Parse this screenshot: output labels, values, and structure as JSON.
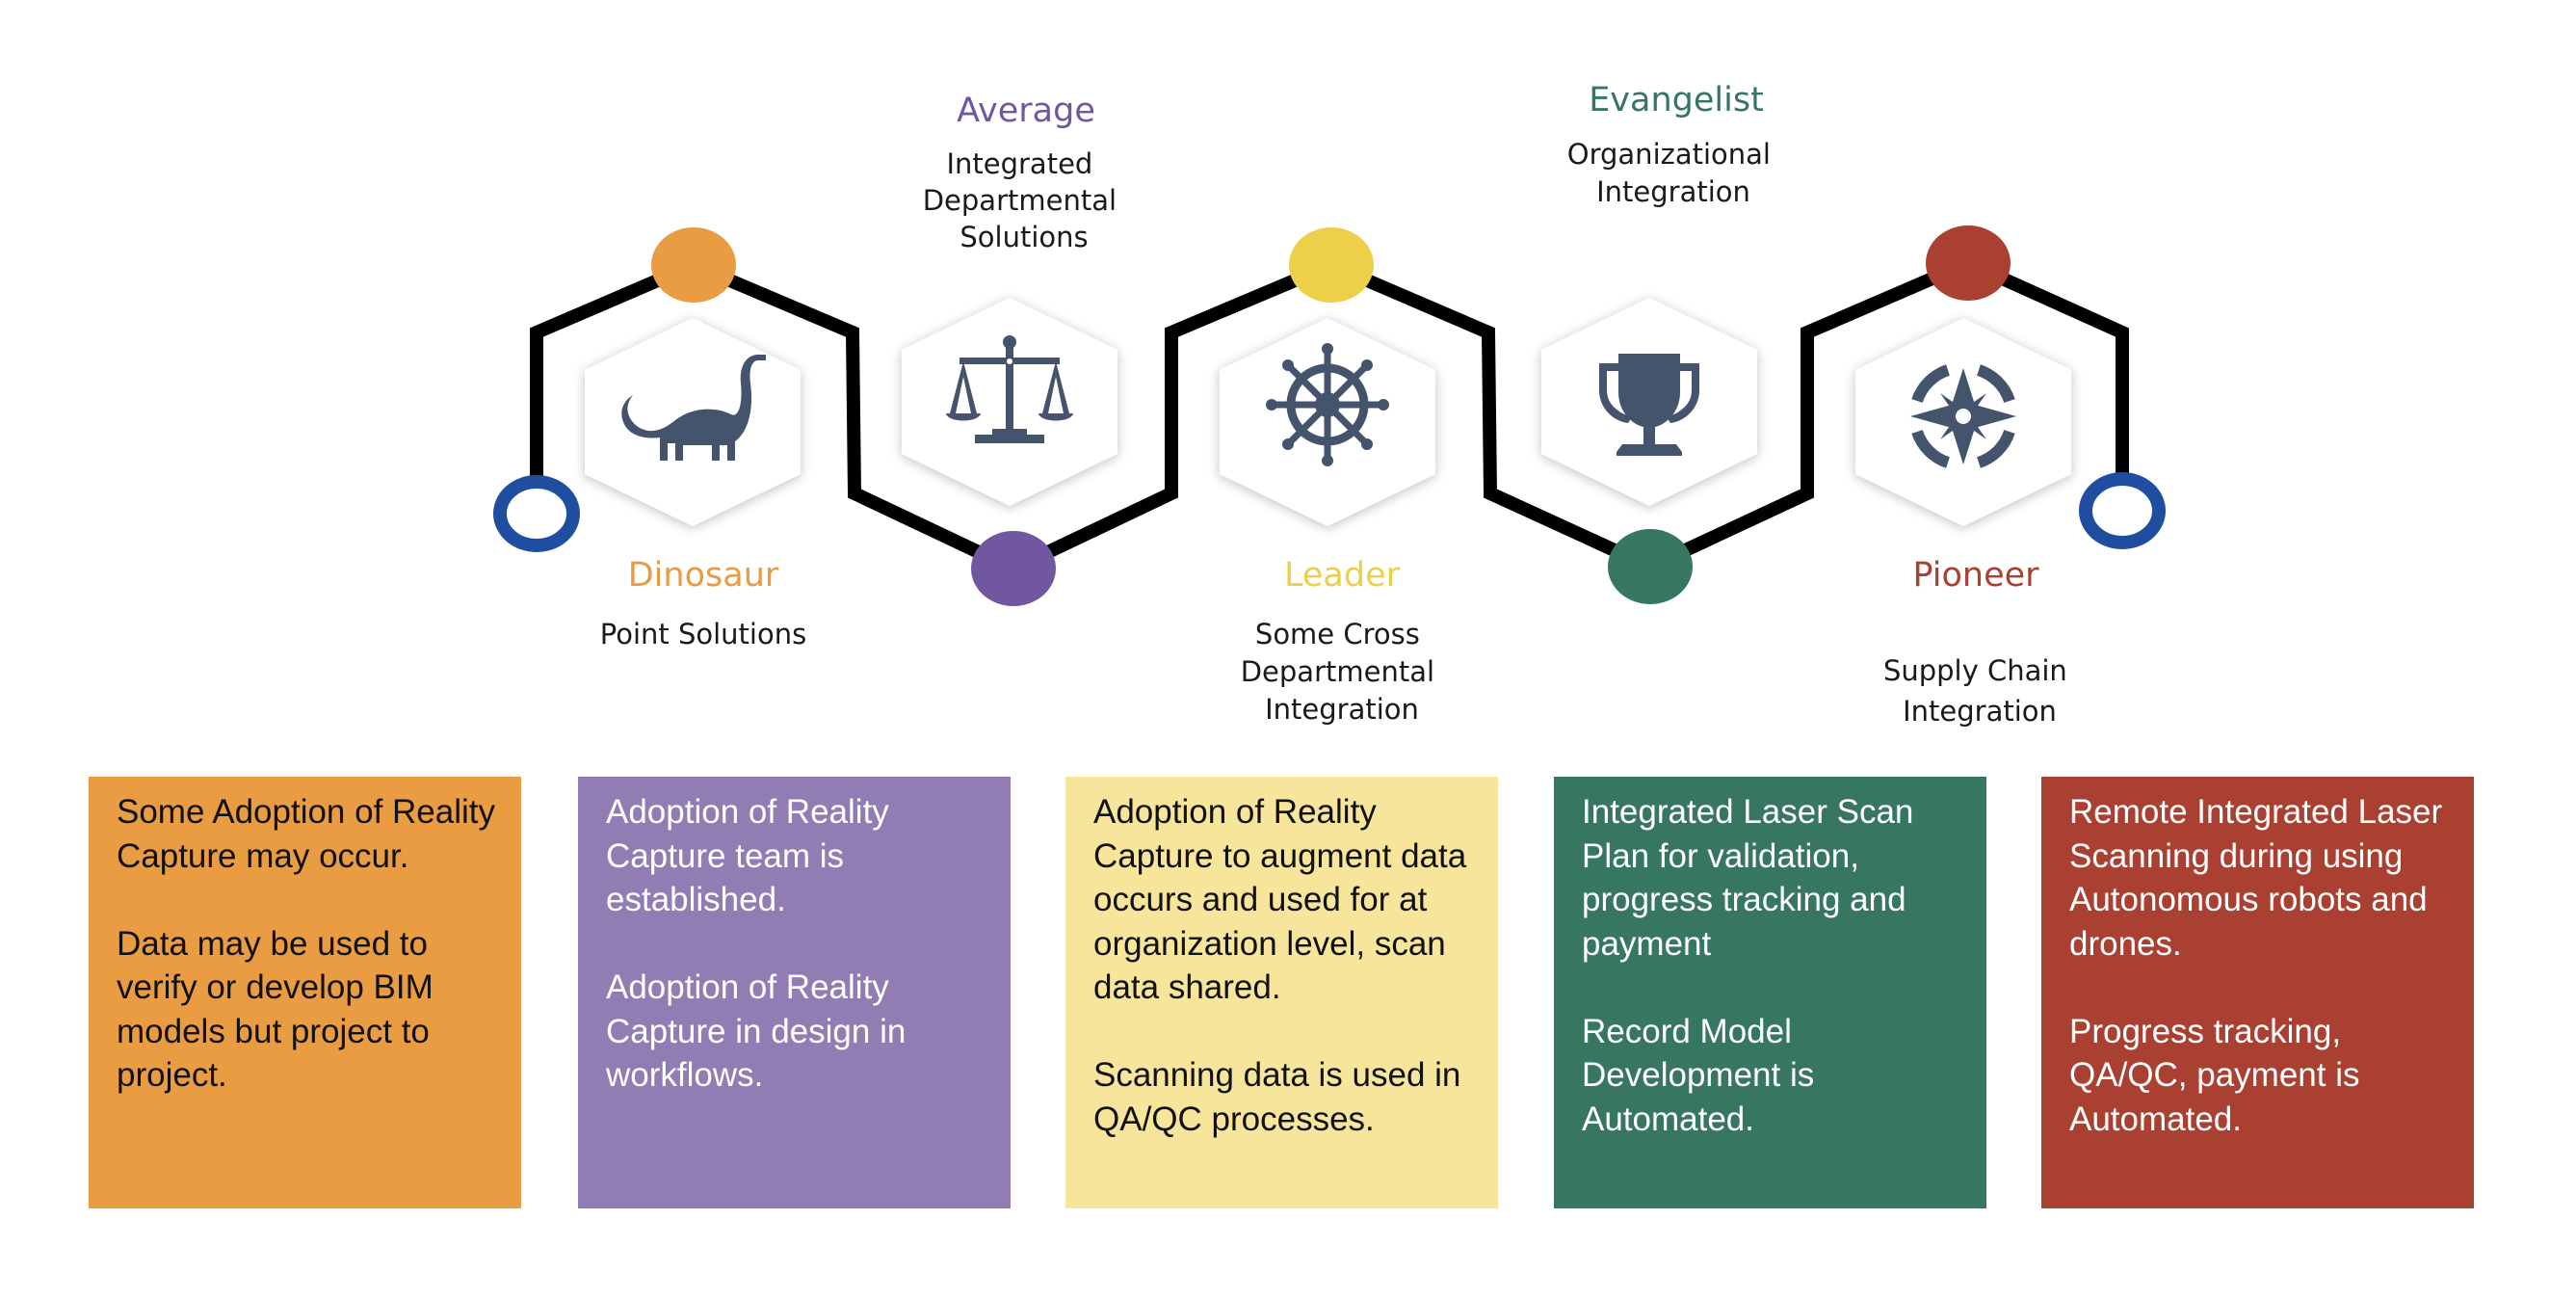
{
  "colors": {
    "path_line": "#000000",
    "end_ring": "#1F4EA0",
    "icon": "#44546C",
    "hex_fill": "#FFFFFF"
  },
  "stages": [
    {
      "name": "Dinosaur",
      "subtitle": [
        "Point Solutions"
      ],
      "icon": "dinosaur-icon",
      "color": "#E99C42",
      "position": "below",
      "box_bg": "#E99C42",
      "box_text_color": "#111111",
      "box_paragraphs": [
        "Some Adoption of Reality Capture may occur.",
        "Data may be used to verify or develop BIM models but project to project."
      ]
    },
    {
      "name": "Average",
      "subtitle": [
        "Integrated",
        "Departmental",
        "Solutions"
      ],
      "icon": "scales-of-justice-icon",
      "color": "#7157A0",
      "position": "above",
      "box_bg": "#917CB4",
      "box_text_color": "#FFFFFF",
      "box_paragraphs": [
        "Adoption of Reality Capture team is established.",
        "Adoption of Reality Capture in design in workflows."
      ]
    },
    {
      "name": "Leader",
      "subtitle": [
        "Some Cross",
        "Departmental",
        "Integration"
      ],
      "icon": "ship-wheel-icon",
      "color": "#EECF4A",
      "position": "below",
      "box_bg": "#F8E59C",
      "box_text_color": "#111111",
      "box_paragraphs": [
        "Adoption of Reality Capture to augment data occurs and used for at organization level, scan data shared.",
        "Scanning data is used in QA/QC processes."
      ]
    },
    {
      "name": "Evangelist",
      "subtitle": [
        "Organizational",
        "Integration"
      ],
      "icon": "trophy-icon",
      "color": "#377661",
      "position": "above",
      "box_bg": "#377661",
      "box_text_color": "#FFFFFF",
      "box_paragraphs": [
        "Integrated Laser Scan Plan for validation, progress tracking and payment",
        "Record Model Development is Automated."
      ]
    },
    {
      "name": "Pioneer",
      "subtitle": [
        "Supply Chain",
        "Integration"
      ],
      "icon": "compass-rose-icon",
      "color": "#A94032",
      "position": "below",
      "box_bg": "#A94032",
      "box_text_color": "#FFFFFF",
      "box_paragraphs": [
        "Remote Integrated Laser Scanning during using Autonomous robots and drones.",
        "Progress tracking, QA/QC, payment is Automated."
      ]
    }
  ]
}
